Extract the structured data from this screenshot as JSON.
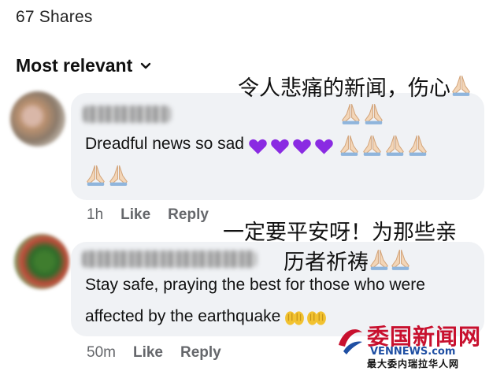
{
  "header": {
    "shares_label": "67 Shares",
    "sort_label": "Most relevant"
  },
  "overlay_captions": {
    "caption_1_line1": "令人悲痛的新闻，伤心",
    "caption_2_line1": "一定要平安呀！为那些亲",
    "caption_2_line2": "历者祈祷"
  },
  "comments": [
    {
      "text_part": "Dreadful news  so sad",
      "time": "1h",
      "like_label": "Like",
      "reply_label": "Reply"
    },
    {
      "text_line1": "Stay safe, praying the best for those who were",
      "text_line2": "affected by the earthquake",
      "time": "50m",
      "like_label": "Like",
      "reply_label": "Reply"
    }
  ],
  "watermark": {
    "title": "委国新闻网",
    "url": "VENNEWS.com",
    "subtitle": "最大委内瑞拉华人网"
  },
  "icons": {
    "heart_color": "#8a2be2",
    "hands_color": "#f3d6b8",
    "watermark_red": "#c8102e",
    "watermark_blue": "#1f4fa3"
  }
}
